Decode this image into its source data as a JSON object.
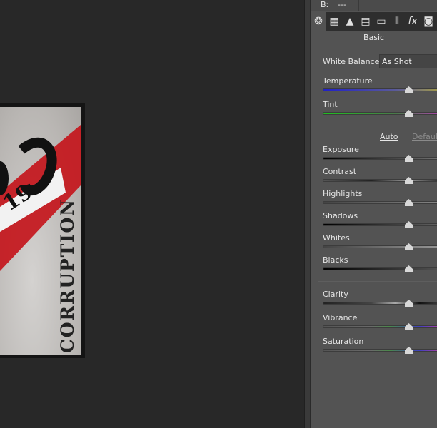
{
  "top_info": {
    "label": "B:",
    "value": "---"
  },
  "tabs": [
    {
      "icon": "aperture-icon",
      "glyph": "❂",
      "active": true
    },
    {
      "icon": "tone-curve-icon",
      "glyph": "▦"
    },
    {
      "icon": "detail-icon",
      "glyph": "▲"
    },
    {
      "icon": "hsl-icon",
      "glyph": "▤"
    },
    {
      "icon": "split-toning-icon",
      "glyph": "▭"
    },
    {
      "icon": "lens-corrections-icon",
      "glyph": "⦀"
    },
    {
      "icon": "fx-icon",
      "glyph": "fx"
    },
    {
      "icon": "camera-calibration-icon",
      "glyph": "◙"
    }
  ],
  "panel_title": "Basic",
  "white_balance": {
    "label": "White Balance:",
    "value": "As Shot"
  },
  "links": {
    "auto": "Auto",
    "default": "Default"
  },
  "sliders": [
    {
      "label": "Temperature",
      "value": 0,
      "gradient": "linear-gradient(90deg,#2020c8,#5a5a9a 60%,#a8a040)"
    },
    {
      "label": "Tint",
      "value": 0,
      "gradient": "linear-gradient(90deg,#20c020,#4a7a4a 60%,#b040b0)"
    },
    {
      "label": "Exposure",
      "value": 0,
      "gradient": "linear-gradient(90deg,#000,#777)"
    },
    {
      "label": "Contrast",
      "value": 0,
      "gradient": "linear-gradient(90deg,#555,#222 40%,#999 70%,#222)"
    },
    {
      "label": "Highlights",
      "value": 0,
      "gradient": "linear-gradient(90deg,#444,#888)"
    },
    {
      "label": "Shadows",
      "value": 0,
      "gradient": "linear-gradient(90deg,#000,#666)"
    },
    {
      "label": "Whites",
      "value": 0,
      "gradient": "linear-gradient(90deg,#444,#999)"
    },
    {
      "label": "Blacks",
      "value": 0,
      "gradient": "linear-gradient(90deg,#000,#555)"
    },
    {
      "label": "Clarity",
      "value": 0,
      "gradient": "linear-gradient(90deg,#222,#444 40%,#aaa 60%,#111 80%,#444)"
    },
    {
      "label": "Vibrance",
      "value": 0,
      "gradient": "linear-gradient(90deg,#555,#6a6a6a 40%,#4a8a4a 55%,#4040c0 80%,#c040a0)"
    },
    {
      "label": "Saturation",
      "value": 0,
      "gradient": "linear-gradient(90deg,#555,#6a6a6a 40%,#4a8a4a 55%,#4040c0 80%,#c040a0)"
    }
  ],
  "image": {
    "text_number": "19",
    "text_word": "CORRUPTION"
  }
}
